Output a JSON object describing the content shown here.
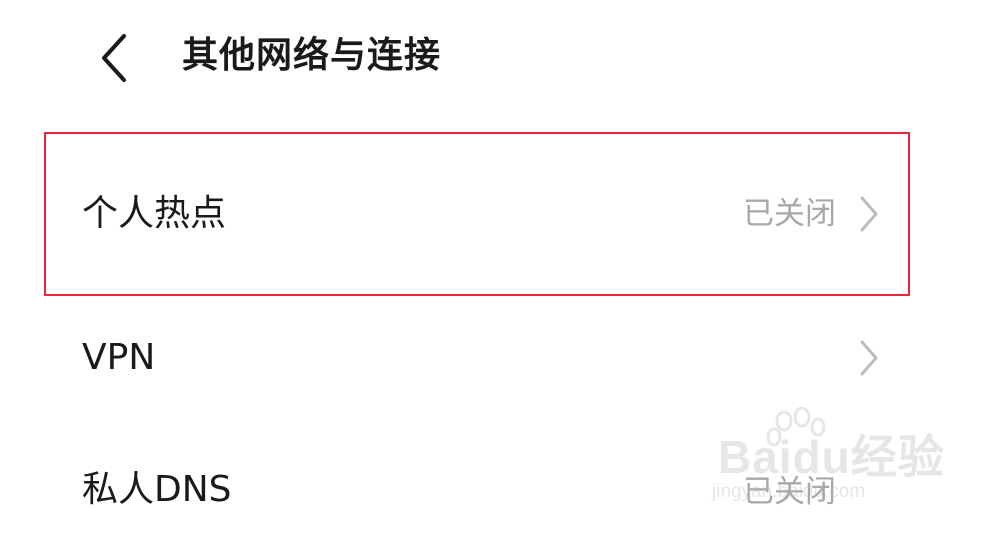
{
  "header": {
    "title": "其他网络与连接",
    "back_icon": "chevron-left-icon"
  },
  "items": [
    {
      "label": "个人热点",
      "value": "已关闭",
      "chevron": "chevron-right-icon"
    },
    {
      "label": "VPN",
      "value": "",
      "chevron": "chevron-right-icon"
    },
    {
      "label": "私人DNS",
      "value": "已关闭",
      "chevron": ""
    }
  ],
  "highlight": {
    "color": "#e8263d"
  },
  "watermark": {
    "brand": "Baidu经验",
    "url": "jingyan.baidu.com"
  }
}
